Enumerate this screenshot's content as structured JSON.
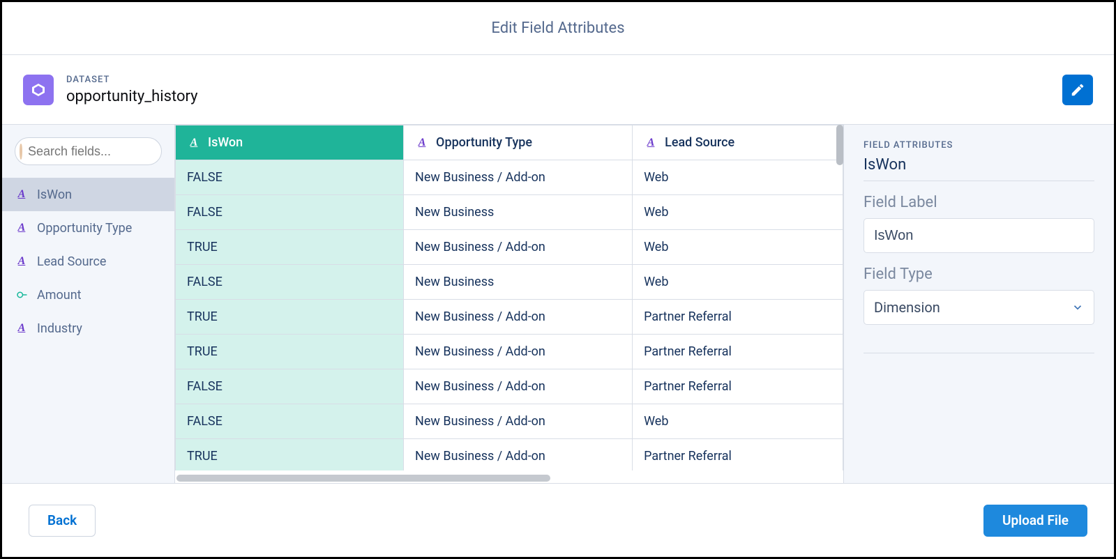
{
  "titlebar": {
    "title": "Edit Field Attributes"
  },
  "header": {
    "kicker": "DATASET",
    "name": "opportunity_history"
  },
  "sidebar": {
    "search_placeholder": "Search fields...",
    "fields": [
      {
        "label": "IsWon",
        "type": "dimension",
        "selected": true
      },
      {
        "label": "Opportunity Type",
        "type": "dimension",
        "selected": false
      },
      {
        "label": "Lead Source",
        "type": "dimension",
        "selected": false
      },
      {
        "label": "Amount",
        "type": "measure",
        "selected": false
      },
      {
        "label": "Industry",
        "type": "dimension",
        "selected": false
      }
    ]
  },
  "table": {
    "columns": [
      {
        "label": "IsWon",
        "type": "dimension",
        "selected": true
      },
      {
        "label": "Opportunity Type",
        "type": "dimension",
        "selected": false
      },
      {
        "label": "Lead Source",
        "type": "dimension",
        "selected": false
      }
    ],
    "rows": [
      [
        "FALSE",
        "New Business / Add-on",
        "Web"
      ],
      [
        "FALSE",
        "New Business",
        "Web"
      ],
      [
        "TRUE",
        "New Business / Add-on",
        "Web"
      ],
      [
        "FALSE",
        "New Business",
        "Web"
      ],
      [
        "TRUE",
        "New Business / Add-on",
        "Partner Referral"
      ],
      [
        "TRUE",
        "New Business / Add-on",
        "Partner Referral"
      ],
      [
        "FALSE",
        "New Business / Add-on",
        "Partner Referral"
      ],
      [
        "FALSE",
        "New Business / Add-on",
        "Web"
      ],
      [
        "TRUE",
        "New Business / Add-on",
        "Partner Referral"
      ]
    ]
  },
  "attributes": {
    "section": "FIELD ATTRIBUTES",
    "field_name": "IsWon",
    "label_heading": "Field Label",
    "label_value": "IsWon",
    "type_heading": "Field Type",
    "type_value": "Dimension"
  },
  "footer": {
    "back": "Back",
    "upload": "Upload File"
  }
}
